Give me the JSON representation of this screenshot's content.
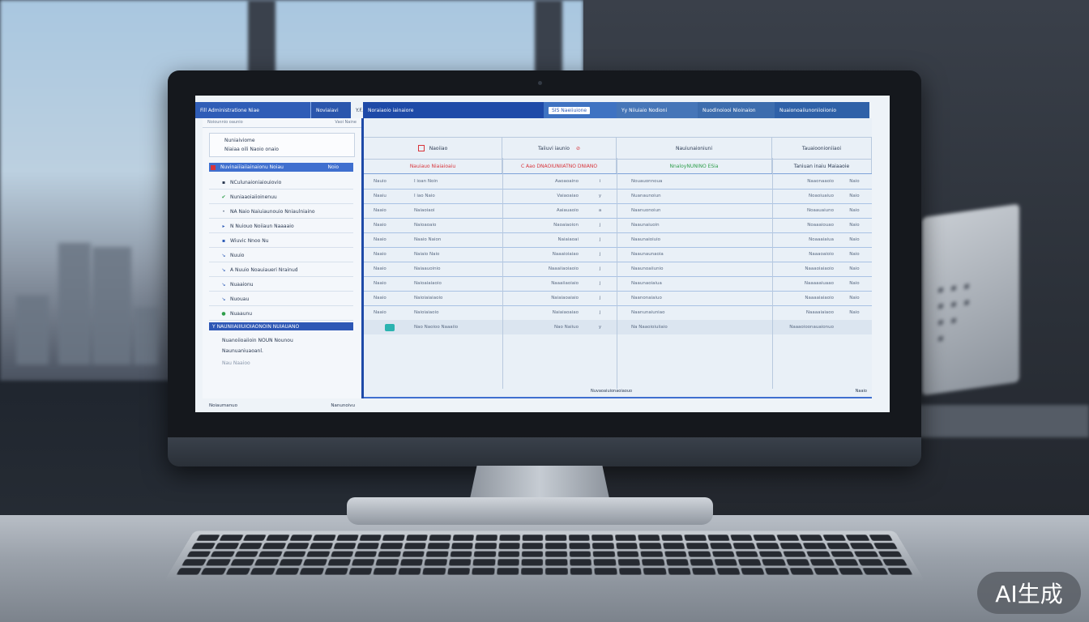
{
  "topbar": {
    "app_title": "Fill Administratione Niae",
    "tab_b": "Noviaiavi",
    "tab_c": "Y.F.",
    "window_title": "Noraiaoio iainaiore",
    "search_label": "SIS Naeiiuione",
    "menu_1": "Yy Niiuiaio Nodioni",
    "menu_2": "Nuodinoiooi Nioinaion",
    "menu_3": "Nuaionoaiiunoniioiionio"
  },
  "sidebar": {
    "top_left": "Noiounnio oaunio",
    "top_right": "Vaoi  Naine",
    "header_line1": "Nuniaiviome",
    "header_line2": "Niaiaa oili Naoio onaio",
    "items": [
      {
        "label": "Nuvinaiiiaiiainaionu  Noiau",
        "right": "Noio"
      },
      {
        "label": "NCulunaioniaiouiovio"
      },
      {
        "label": "Nuniaaoiaiioinenuu"
      },
      {
        "label": "NA Naio Naiuiaunouio Nniaulniaino"
      },
      {
        "label": "N Nuiouo Noiiaun  Naaaaio"
      },
      {
        "label": "Wiuvic Nnoo Nu"
      },
      {
        "label": "Nuuio"
      },
      {
        "label": "A Nuuio Noauiaueri Nrainud"
      },
      {
        "label": "Nuaaionu"
      },
      {
        "label": "Nuouau"
      },
      {
        "label": "Nuaaunu"
      },
      {
        "label": "Y  NAUNIIAIIIUIOIAONOIN NUIAUANO"
      },
      {
        "label": "Nuanoiioaiioin NOUN  Nounou"
      },
      {
        "label": "Naunuaniuaoanl."
      },
      {
        "label": "Nau     Naaioo"
      }
    ],
    "footer_left": "Noiaumanuo",
    "footer_right": "Nanunoivu"
  },
  "main": {
    "col_headers": [
      "Naoiiao",
      "Taiiuvi iaunio",
      "Nauiunaioniuni",
      "Tauaioonioniiaoi"
    ],
    "subheaders": [
      "Nauiauo Niaiaioaiu",
      "C Aao DNAOIUNIIATNO DNIANO",
      "NnaloyNUNINO ESia",
      "Taniuan  inaiu  Maiaaoie"
    ],
    "rows": [
      [
        "Nauio",
        "I ioan Noin",
        "Aaoaoaino",
        "i",
        "Nouauonnoua",
        "Naaonaaoio",
        "Naio"
      ],
      [
        "Naaiu",
        "I iao Naio",
        "Vaiaoaiao",
        "y",
        "Nuanaunoiun",
        "Noaoiuaiuo",
        "Naio"
      ],
      [
        "Naaio",
        "Naiaoiaoi",
        "Aaiauaoio",
        "a",
        "Naanuonoiun",
        "Noaauaiuno",
        "Naio"
      ],
      [
        "Naaio",
        "Naioaoaio",
        "Naoaiaoion",
        "j",
        "Naaunaiuoin",
        "Noaaaiouao",
        "Naio"
      ],
      [
        "Naaio",
        "Naaio Naion",
        "Naiaiaoai",
        "j",
        "Naaunaioiuio",
        "Noaaaiaiua",
        "Naio"
      ],
      [
        "Naaio",
        "Naiaio Naio",
        "Naaaioiaiao",
        "j",
        "Naaunaunaoia",
        "Naaaoaioio",
        "Naio"
      ],
      [
        "Naaio",
        "Naiaauoinio",
        "Naaaiiaoiaoio",
        "j",
        "Naaunoaiiunio",
        "Naaaoiaiaoio",
        "Naio"
      ],
      [
        "Naaio",
        "Naioaiaiaoio",
        "Naaaiiaoiaio",
        "j",
        "Naaunaoiaiua",
        "Naaaaaiuaao",
        "Naio"
      ],
      [
        "Naaio",
        "Naioiaiaiaoio",
        "Naiaiaoaiaio",
        "j",
        "Naanonaiaiuo",
        "Naaaaiaiaoio",
        "Naio"
      ],
      [
        "Naaio",
        "Naioiaiaoio",
        "Naiaiaoaiao",
        "j",
        "Naanunaiuniao",
        "Naaaaiaiaoo",
        "Naio"
      ]
    ],
    "last_row": {
      "c2": "Nao Naoioo  Naaaiio",
      "c3": "Nao Naiiuo",
      "c4": "y",
      "c5": "Na  Naaoioiuiiaio",
      "c6": "Naaaoioonauaionuo"
    },
    "footer_center": "Nuvaoaiuionaoiaouo",
    "footer_right": "Naaio"
  },
  "watermark": "AI生成",
  "colors": {
    "accent": "#1e4aa8",
    "primary_blue": "#3f6fcf",
    "alert_red": "#d8343a",
    "success_green": "#2e9e4a",
    "teal": "#2bb3b0"
  }
}
